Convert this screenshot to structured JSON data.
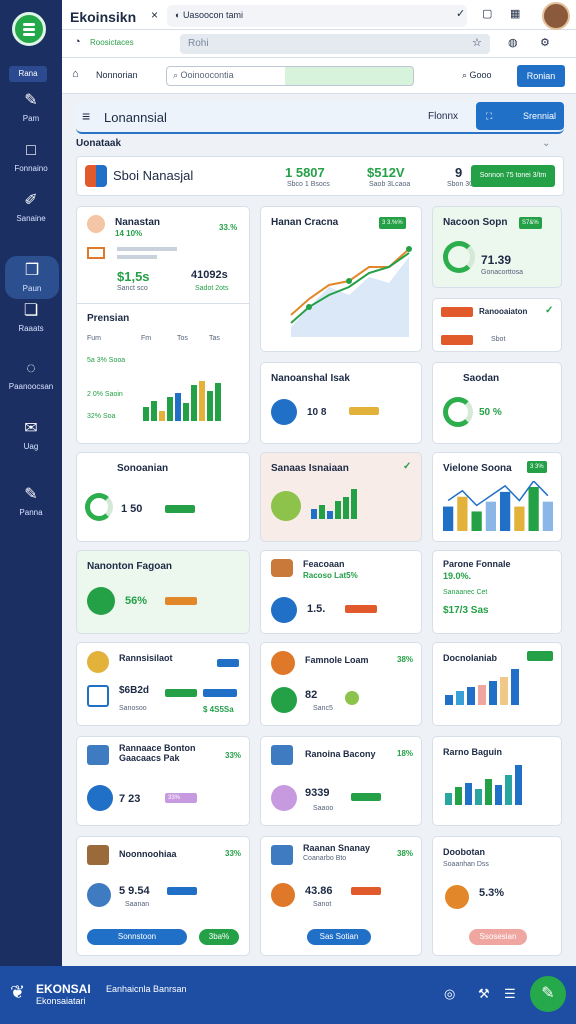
{
  "browser": {
    "tab_title": "Ekoinsikn",
    "tab_close": "×",
    "tab2_label": "Uasoocon tami",
    "address_label": "Roosictaces",
    "addr_placeholder": "Rohi",
    "window_check": "✓"
  },
  "sidebar": {
    "label": "Rana",
    "items": [
      {
        "label": "Pam",
        "icon": "✎"
      },
      {
        "label": "Fonnaino",
        "icon": "□"
      },
      {
        "label": "Sanaine",
        "icon": "✐"
      },
      {
        "label": "Paun",
        "icon": "❒"
      },
      {
        "label": "Raaats",
        "icon": "❏"
      },
      {
        "label": "Paanoocsan",
        "icon": "◌"
      },
      {
        "label": "Uag",
        "icon": "✉"
      },
      {
        "label": "Panna",
        "icon": "✎"
      }
    ]
  },
  "toolbar": {
    "home": "Nonnorian",
    "search_value": "Ooinoocontia",
    "right_label": "Gooo",
    "button": "Ronian"
  },
  "header": {
    "title": "Lonannsial",
    "right_name": "Flonnx",
    "button": "Srennial"
  },
  "subheader": {
    "left": "Uonataak",
    "right": "⌄"
  },
  "summary": {
    "title": "Sboi Nanasjal",
    "val1": "1 5807",
    "cap1": "Sbco 1 Bsocs",
    "val2": "$512V",
    "cap2": "Saob 3Lcaoa",
    "val3": "9",
    "cap3": "Sbon 3000s",
    "button": "Sonnon 75 tonei 3/tm"
  },
  "cards": {
    "a": {
      "title": "Nanastan",
      "pct": "33.%",
      "sub": "14 10%",
      "v1": "$1,5s",
      "v2": "41092s",
      "cap1": "Sanct sco",
      "cap2": "Sadot 2ots",
      "section": "Prensian",
      "cols": [
        "Fum",
        "Fm",
        "Tos",
        "Tas"
      ],
      "rows": [
        "5a 3% Sooa",
        "2 0% Saoin",
        "32% Soa"
      ]
    },
    "b": {
      "title": "Hanan Cracna",
      "badge": "3 3.%%"
    },
    "c": {
      "title": "Nacoon Sopn",
      "badge": "S7&%",
      "value": "71.39",
      "cap": "Gonacorttosa"
    },
    "d": {
      "title": "Ranooaiaton",
      "amount": "Sbot"
    },
    "e": {
      "title": "Nanoanshal Isak",
      "value": "10 8"
    },
    "f": {
      "title": "Saodan",
      "value": "50 %"
    },
    "g": {
      "title": "Sonoanian",
      "value": "1 50"
    },
    "h": {
      "title": "Sanaas Isnaiaan"
    },
    "i": {
      "title": "Vielone Soona",
      "badge": "3 3%"
    },
    "j": {
      "title": "Nanonton Fagoan",
      "value": "56%"
    },
    "k": {
      "title": "Feacoaan",
      "sub": "Racoso Lat5%",
      "value": "1.5."
    },
    "l": {
      "title": "Parone Fonnale",
      "sub": "19.0%.",
      "line1": "Sanaanec Cet",
      "line2": "$17/3 Sas"
    },
    "m": {
      "title": "Rannsisilaot",
      "value": "$6B2d",
      "cap": "Sanosoo",
      "badge": "$ 4S5Sa"
    },
    "n": {
      "title": "Famnole Loam",
      "pct": "38%",
      "value": "82",
      "cap": "Sanc5"
    },
    "o": {
      "title": "Docnolaniab"
    },
    "p": {
      "title": "Rannaace Bonton",
      "sub": "Gaacaacs Pak",
      "pct": "33%",
      "value": "7 23",
      "badge": "33%"
    },
    "q": {
      "title": "Ranoina Bacony",
      "pct": "18%",
      "value": "9339",
      "cap": "Saaoo"
    },
    "r": {
      "title": "Rarno Baguin"
    },
    "s": {
      "title": "Noonnoohiaa",
      "pct": "33%",
      "value": "5 9.54",
      "cap": "Saanan"
    },
    "t": {
      "title": "Raanan Snanay",
      "sub": "Coanarbo Bto",
      "pct": "38%",
      "value": "43.86",
      "cap": "Sanot"
    },
    "u": {
      "title": "Doobotan",
      "sub": "Soaanhan Dss",
      "value": "5.3%"
    }
  },
  "actions": {
    "a": "Sonnstoon",
    "b": "3ba%",
    "c": "Sas Sotian",
    "d": "Ssosesian"
  },
  "footer": {
    "brand": "EKONSAI",
    "sub": "Ekonsaiatari",
    "mid": "Eanhaicnla Banrsan"
  },
  "colors": {
    "navy": "#1b2f63",
    "green": "#24a047",
    "blue": "#2170c8"
  },
  "chart_data": {
    "type": "bar",
    "title": "Vielone Soona",
    "categories": [
      "1",
      "2",
      "3",
      "4",
      "5",
      "6",
      "7",
      "8"
    ],
    "values": [
      5,
      7,
      4,
      6,
      8,
      5,
      9,
      6
    ]
  }
}
